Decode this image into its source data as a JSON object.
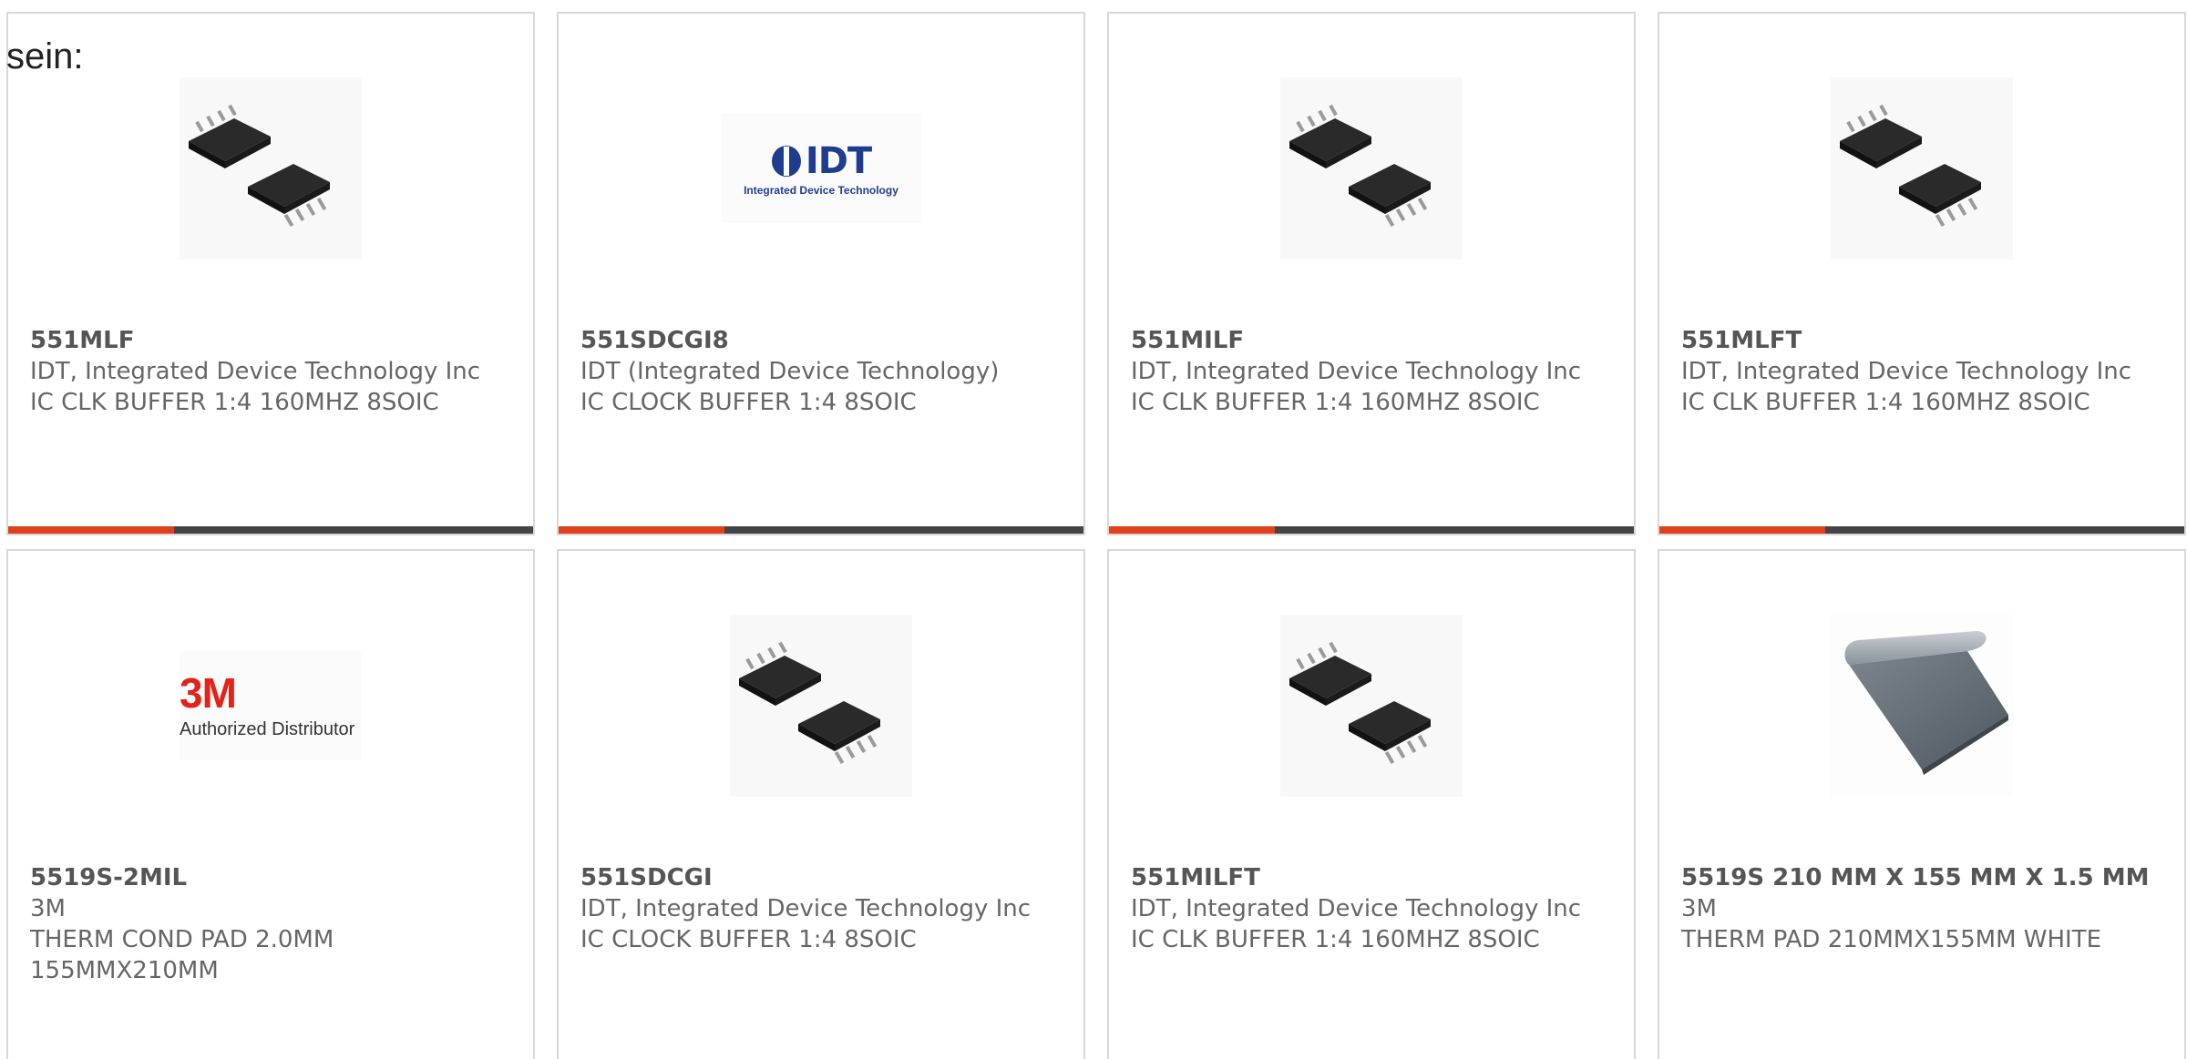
{
  "intro_text": "sein:",
  "colors": {
    "accent": "#e0401a",
    "bar": "#444444",
    "border": "#d8d8d8"
  },
  "products": [
    {
      "part_number": "551MLF",
      "manufacturer": "IDT, Integrated Device Technology Inc",
      "description": "IC CLK BUFFER 1:4 160MHZ 8SOIC",
      "image": "soic-chip-photo"
    },
    {
      "part_number": "551SDCGI8",
      "manufacturer": "IDT (Integrated Device Technology)",
      "description": "IC CLOCK BUFFER 1:4 8SOIC",
      "image": "idt-logo",
      "logo_text": "IDT",
      "logo_subtext": "Integrated Device Technology"
    },
    {
      "part_number": "551MILF",
      "manufacturer": "IDT, Integrated Device Technology Inc",
      "description": "IC CLK BUFFER 1:4 160MHZ 8SOIC",
      "image": "soic-chip-photo"
    },
    {
      "part_number": "551MLFT",
      "manufacturer": "IDT, Integrated Device Technology Inc",
      "description": "IC CLK BUFFER 1:4 160MHZ 8SOIC",
      "image": "soic-chip-photo"
    },
    {
      "part_number": "5519S-2MIL",
      "manufacturer": "3M",
      "description": "THERM COND PAD 2.0MM 155MMX210MM",
      "image": "3m-logo",
      "logo_text": "3M",
      "logo_subtext": "Authorized Distributor"
    },
    {
      "part_number": "551SDCGI",
      "manufacturer": "IDT, Integrated Device Technology Inc",
      "description": "IC CLOCK BUFFER 1:4 8SOIC",
      "image": "soic-chip-photo"
    },
    {
      "part_number": "551MILFT",
      "manufacturer": "IDT, Integrated Device Technology Inc",
      "description": "IC CLK BUFFER 1:4 160MHZ 8SOIC",
      "image": "soic-chip-photo"
    },
    {
      "part_number": "5519S 210 MM X 155 MM X 1.5 MM",
      "manufacturer": "3M",
      "description": "THERM PAD 210MMX155MM WHITE",
      "image": "thermal-pad-photo"
    }
  ]
}
